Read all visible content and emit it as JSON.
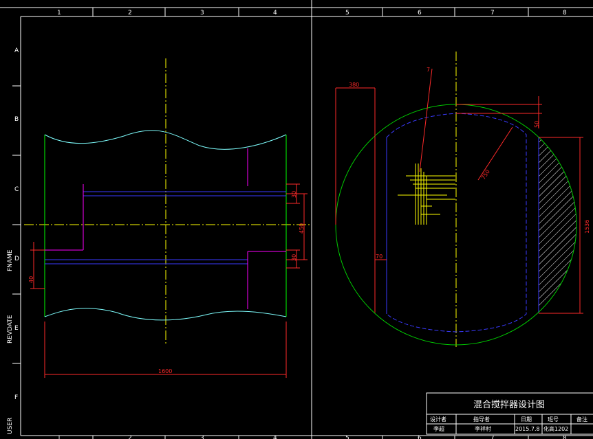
{
  "colors": {
    "background": "#000000",
    "frame": "#ffffff",
    "outline": "#00ff00",
    "curve": "#7fffff",
    "blue": "#0000ff",
    "magenta": "#ff00ff",
    "centerline": "#ffff00",
    "dimension": "#ff0000",
    "hatch": "#ffffff"
  },
  "grid": {
    "columns": [
      "1",
      "2",
      "3",
      "4",
      "5",
      "6",
      "7",
      "8"
    ],
    "rows": [
      "A",
      "B",
      "C",
      "D",
      "E",
      "F"
    ]
  },
  "margin_labels": {
    "fname": "FNAME",
    "revdate": "REVDATE",
    "user": "USER"
  },
  "dimensions": {
    "total_length": "1600",
    "gap_small": "30",
    "gap_small_2": "30",
    "height_mid": "450",
    "left_offset": "40",
    "top_width": "380",
    "leader": "7",
    "radius": "750",
    "top_gap": "50",
    "inner_offset": "70",
    "right_height": "1536"
  },
  "title_block": {
    "title": "混合搅拌器设计图",
    "headers": [
      "设计者",
      "指导者",
      "日期",
      "班号",
      "备注"
    ],
    "values": [
      "李超",
      "李祥村",
      "2015.7.8",
      "化高1202",
      ""
    ]
  }
}
